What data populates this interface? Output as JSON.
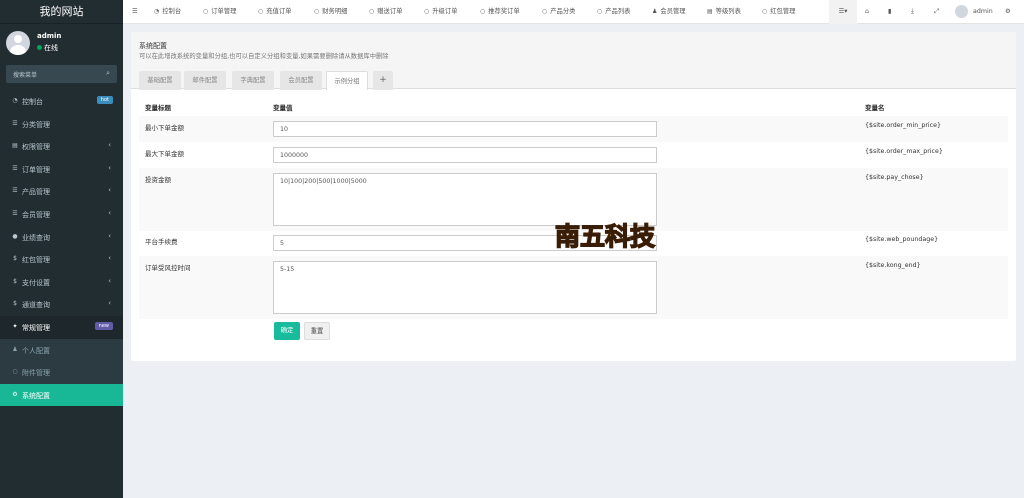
{
  "app": {
    "title": "我的网站"
  },
  "user": {
    "name": "admin",
    "status": "在线"
  },
  "search": {
    "placeholder": "搜索菜单"
  },
  "sidebar": {
    "items": [
      {
        "label": "控制台",
        "badge": "hot",
        "badge_color": "#3c8dbc"
      },
      {
        "label": "分类管理"
      },
      {
        "label": "权限管理",
        "arrow": "‹"
      },
      {
        "label": "订单管理",
        "arrow": "‹"
      },
      {
        "label": "产品管理",
        "arrow": "‹"
      },
      {
        "label": "会员管理",
        "arrow": "‹"
      },
      {
        "label": "业绩查询",
        "arrow": "‹"
      },
      {
        "label": "红包管理",
        "arrow": "‹"
      },
      {
        "label": "支付设置",
        "arrow": "‹"
      },
      {
        "label": "通道查询",
        "arrow": "‹"
      },
      {
        "label": "常规管理",
        "badge": "new",
        "badge_color": "#605ca8"
      },
      {
        "label": "个人配置"
      },
      {
        "label": "附件管理"
      },
      {
        "label": "系统配置"
      }
    ]
  },
  "topnav": {
    "items": [
      "控制台",
      "订单管理",
      "充值订单",
      "财务明细",
      "赠送订单",
      "升级订单",
      "推荐奖订单",
      "产品分类",
      "产品列表",
      "会员管理",
      "等级列表",
      "红包管理"
    ],
    "admin": "admin"
  },
  "panel": {
    "title": "系统配置",
    "desc": "可以在此增改系统的变量和分组,也可以自定义分组和变量,如果需要删除请从数据库中删除",
    "tabs": [
      "基础配置",
      "邮件配置",
      "字典配置",
      "会员配置",
      "示例分组",
      "+"
    ]
  },
  "table": {
    "headers": {
      "title": "变量标题",
      "value": "变量值",
      "name": "变量名"
    },
    "rows": [
      {
        "title": "最小下单金额",
        "value": "10",
        "name": "{$site.order_min_price}"
      },
      {
        "title": "最大下单金额",
        "value": "1000000",
        "name": "{$site.order_max_price}"
      },
      {
        "title": "投资金额",
        "value": "10|100|200|500|1000|5000",
        "name": "{$site.pay_chose}"
      },
      {
        "title": "平台手续费",
        "value": "5",
        "name": "{$site.web_poundage}"
      },
      {
        "title": "订单受风控时间",
        "value": "5-15",
        "name": "{$site.kong_end}"
      }
    ]
  },
  "buttons": {
    "ok": "确定",
    "reset": "重置"
  },
  "watermark": {
    "text": "南五科技"
  },
  "colors": {
    "accent": "#18bc9c",
    "sidebar": "#222d32"
  }
}
